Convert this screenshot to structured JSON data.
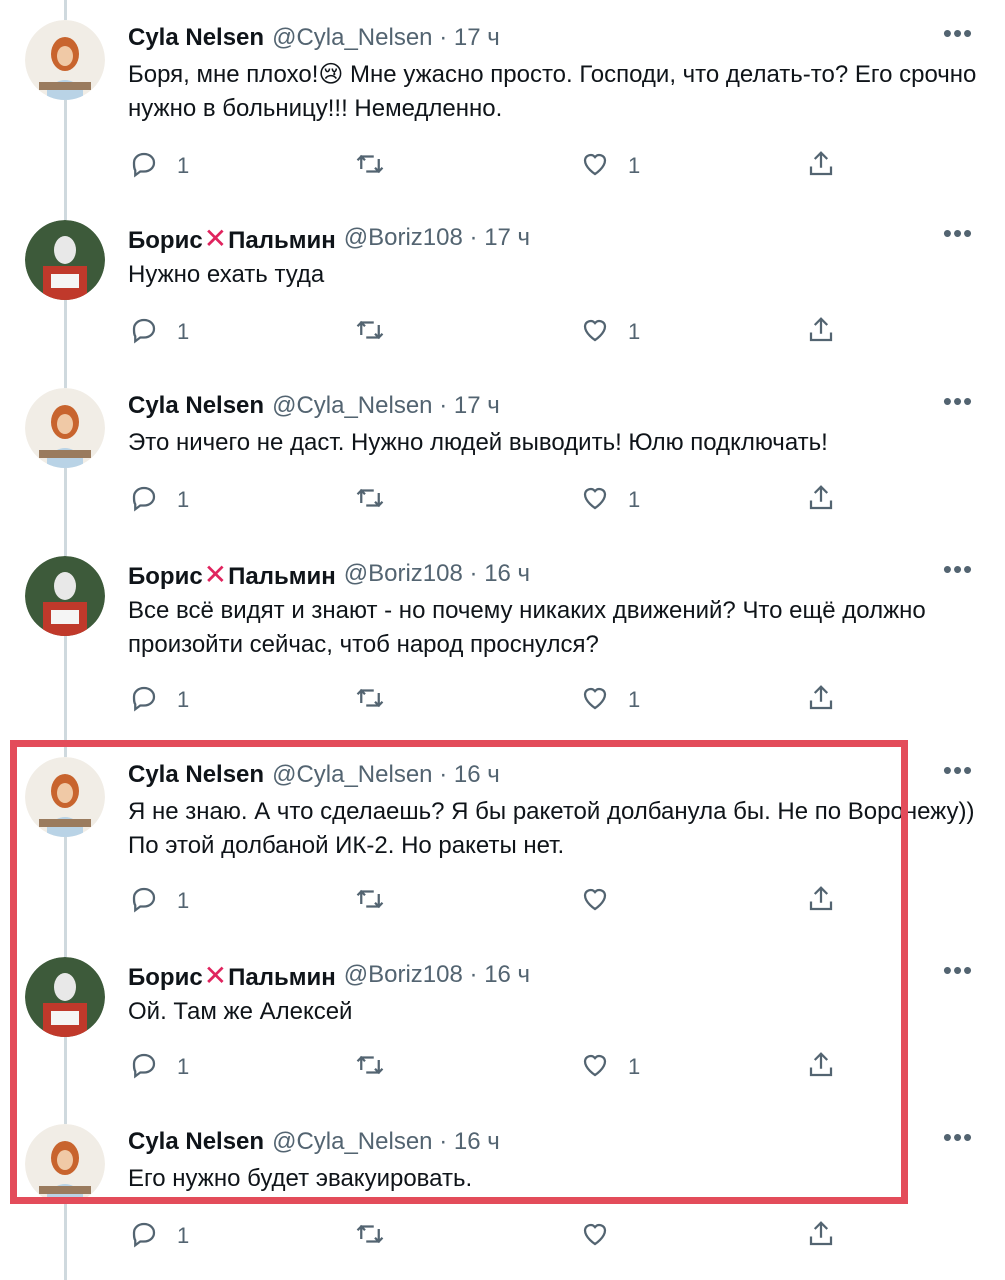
{
  "users": {
    "cyla": {
      "name": "Cyla Nelsen",
      "handle": "@Cyla_Nelsen"
    },
    "boris": {
      "name_first": "Борис",
      "name_cross": "✕",
      "name_last": "Пальмин",
      "handle": "@Boriz108"
    }
  },
  "tweets": [
    {
      "user": "cyla",
      "time": "17 ч",
      "text": "Боря, мне плохо!😢 Мне ужасно просто. Господи, что делать-то? Его срочно нужно в больницу!!! Немедленно.",
      "replies": "1",
      "likes": "1"
    },
    {
      "user": "boris",
      "time": "17 ч",
      "text": "Нужно ехать туда",
      "replies": "1",
      "likes": "1"
    },
    {
      "user": "cyla",
      "time": "17 ч",
      "text": "Это ничего не даст. Нужно людей выводить! Юлю подключать!",
      "replies": "1",
      "likes": "1"
    },
    {
      "user": "boris",
      "time": "16 ч",
      "text": "Все всё видят и знают - но почему никаких движений? Что ещё должно произойти сейчас, чтоб народ проснулся?",
      "replies": "1",
      "likes": "1"
    },
    {
      "user": "cyla",
      "time": "16 ч",
      "text": "Я не знаю. А что сделаешь? Я бы ракетой долбанула бы. Не по Воронежу)) По этой долбаной ИК-2. Но ракеты нет.",
      "replies": "1",
      "likes": ""
    },
    {
      "user": "boris",
      "time": "16 ч",
      "text": "Ой. Там же Алексей",
      "replies": "1",
      "likes": "1"
    },
    {
      "user": "cyla",
      "time": "16 ч",
      "text": "Его нужно будет эвакуировать.",
      "replies": "1",
      "likes": ""
    }
  ],
  "separator": "·",
  "more_label": "•••",
  "icons": [
    "reply-icon",
    "retweet-icon",
    "like-icon",
    "share-icon",
    "more-icon"
  ],
  "colors": {
    "highlight": "#e34c5a",
    "meta": "#536471",
    "cross": "#e0245e",
    "thread_line": "#cfd9de"
  }
}
